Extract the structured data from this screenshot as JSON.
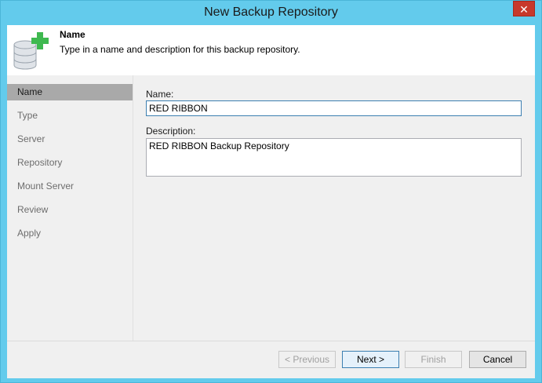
{
  "window": {
    "title": "New Backup Repository",
    "close_label": "✕",
    "accent_color": "#63cbec"
  },
  "header": {
    "icon": "database-add-icon",
    "title": "Name",
    "description": "Type in a name and description for this backup repository."
  },
  "sidebar": {
    "items": [
      {
        "label": "Name",
        "active": true
      },
      {
        "label": "Type",
        "active": false
      },
      {
        "label": "Server",
        "active": false
      },
      {
        "label": "Repository",
        "active": false
      },
      {
        "label": "Mount Server",
        "active": false
      },
      {
        "label": "Review",
        "active": false
      },
      {
        "label": "Apply",
        "active": false
      }
    ]
  },
  "form": {
    "name_label": "Name:",
    "name_value": "RED RIBBON",
    "description_label": "Description:",
    "description_value": "RED RIBBON Backup Repository"
  },
  "footer": {
    "previous_label": "< Previous",
    "next_label": "Next >",
    "finish_label": "Finish",
    "cancel_label": "Cancel"
  }
}
